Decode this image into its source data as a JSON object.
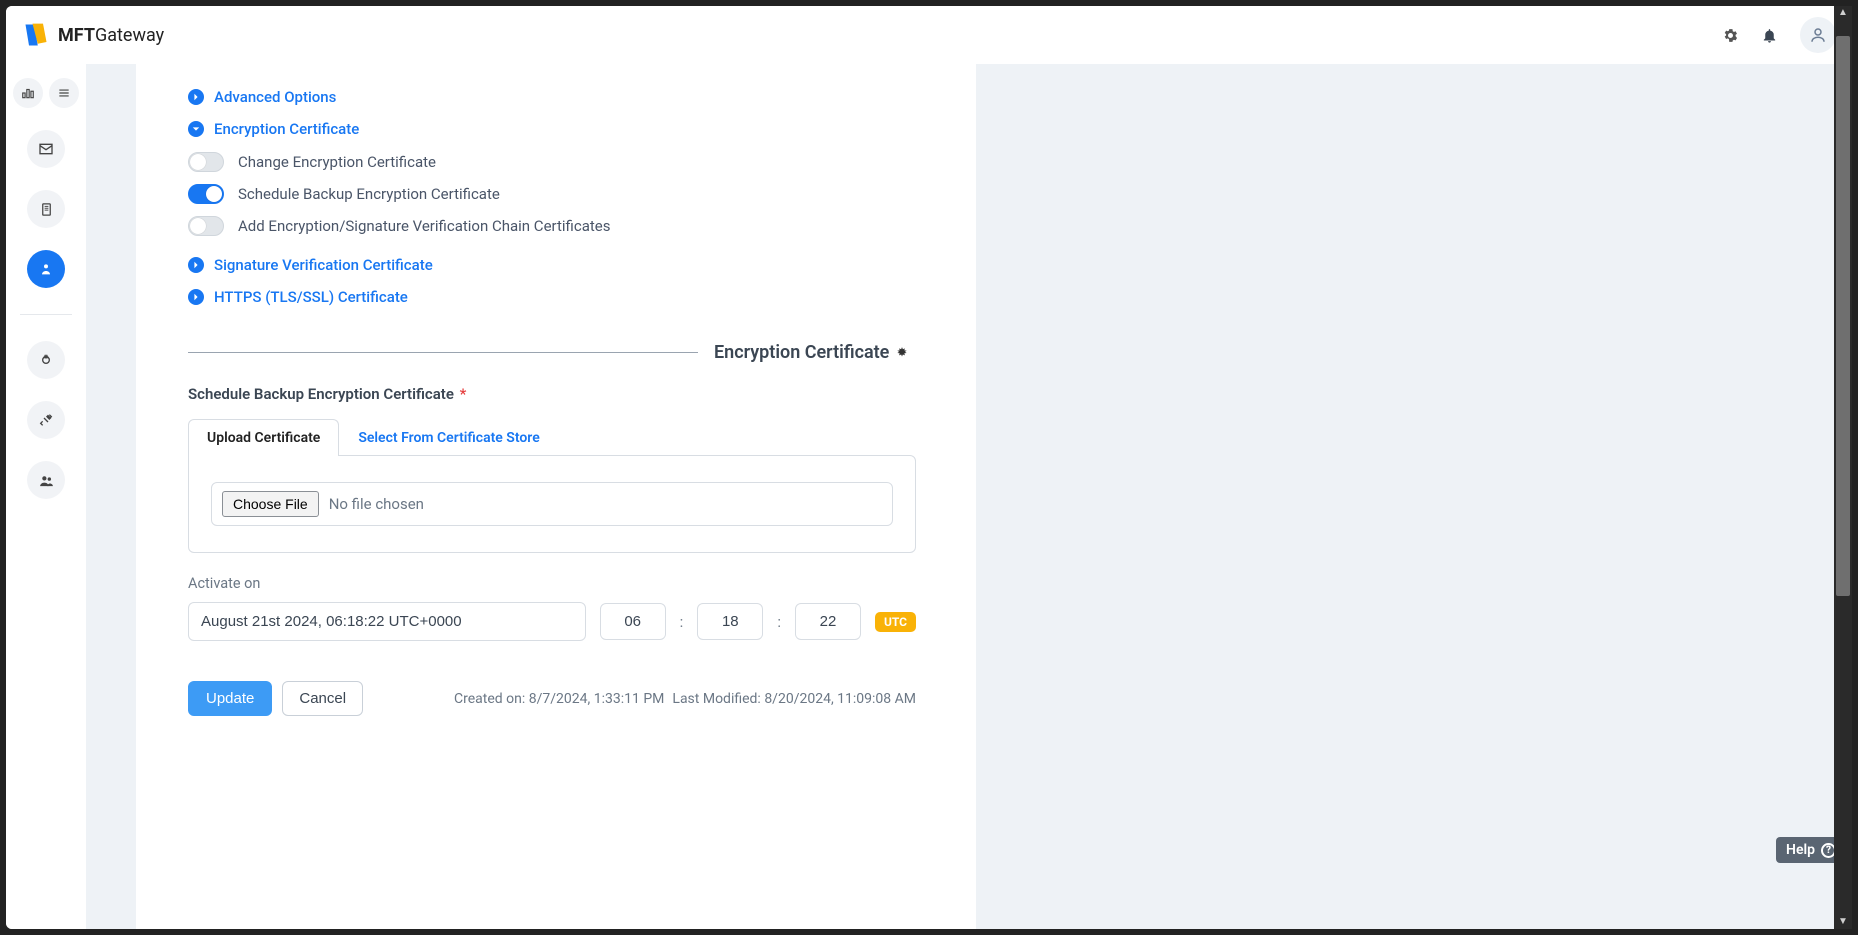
{
  "brand": {
    "bold": "MFT",
    "rest": "Gateway"
  },
  "sections": {
    "advanced": "Advanced Options",
    "encryption": "Encryption Certificate",
    "signature": "Signature Verification Certificate",
    "https": "HTTPS (TLS/SSL) Certificate"
  },
  "toggles": {
    "change": "Change Encryption Certificate",
    "schedule": "Schedule Backup Encryption Certificate",
    "chain": "Add Encryption/Signature Verification Chain Certificates"
  },
  "divider_title": "Encryption Certificate",
  "field": {
    "label": "Schedule Backup Encryption Certificate",
    "required": "*"
  },
  "tabs": {
    "upload": "Upload Certificate",
    "store": "Select From Certificate Store"
  },
  "file": {
    "choose": "Choose File",
    "status": "No file chosen"
  },
  "activate": {
    "label": "Activate on",
    "value": "August 21st 2024, 06:18:22 UTC+0000",
    "hh": "06",
    "mm": "18",
    "ss": "22",
    "tz": "UTC"
  },
  "buttons": {
    "update": "Update",
    "cancel": "Cancel"
  },
  "meta": {
    "created_label": "Created on:",
    "created_value": "8/7/2024, 1:33:11 PM",
    "modified_label": "Last Modified:",
    "modified_value": "8/20/2024, 11:09:08 AM"
  },
  "help": "Help"
}
